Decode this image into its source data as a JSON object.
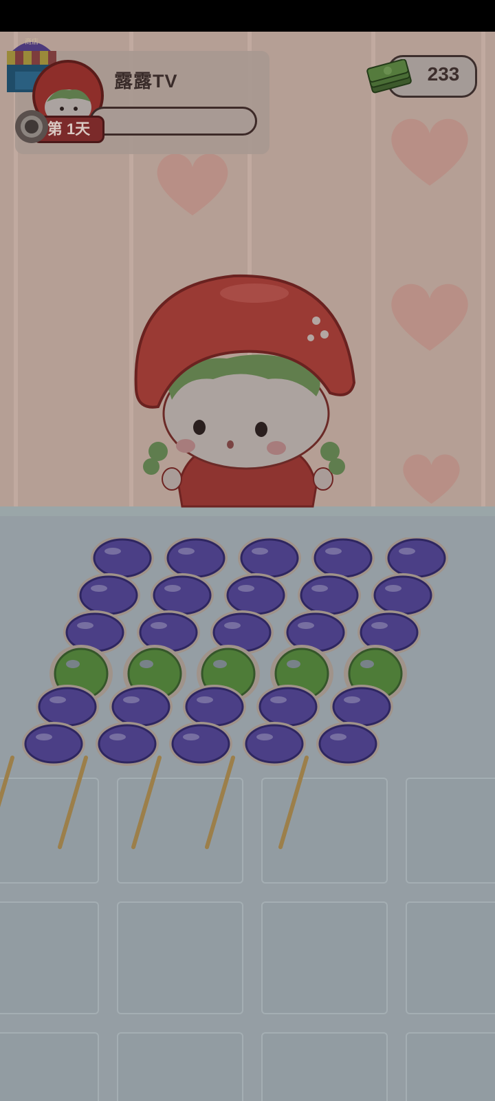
{
  "header": {
    "player_name": "露露TV",
    "day_label": "第 1天",
    "money": "233"
  },
  "game": {
    "columns": 5,
    "skewer_rows": [
      "purple",
      "purple",
      "purple",
      "green",
      "purple",
      "purple"
    ]
  },
  "colors": {
    "purple_bead": "#4b3f86",
    "green_bead": "#4e7c38",
    "stick": "#9c7f4a",
    "hat": "#9a3a34",
    "heart": "#b88c84"
  },
  "icons": {
    "shop": "shop-stall-icon",
    "money": "cash-stack-icon",
    "toggle": "toggle-knob-icon"
  }
}
